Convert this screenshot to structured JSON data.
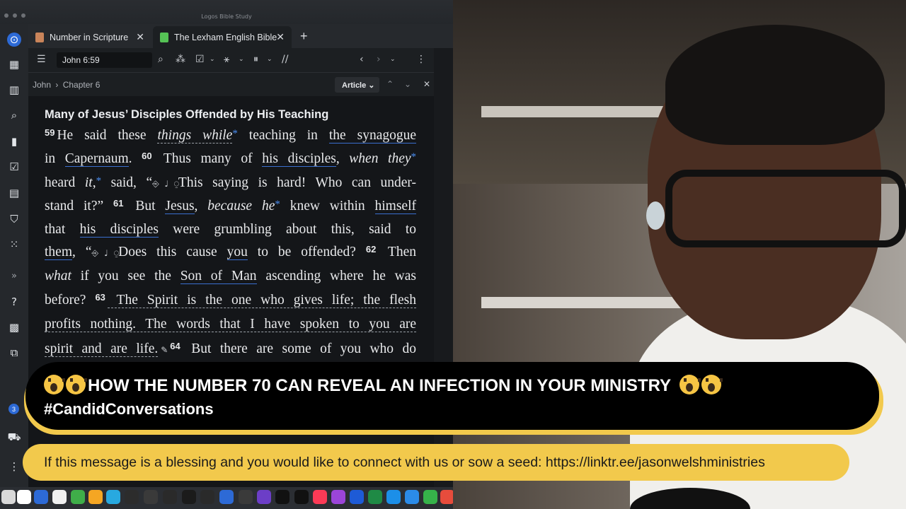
{
  "window": {
    "title": "Logos Bible Study"
  },
  "tabs": [
    {
      "label": "Number in Scripture",
      "icon_color": "#c9845a"
    },
    {
      "label": "The Lexham English Bible",
      "icon_color": "#55c255"
    }
  ],
  "toolbar": {
    "reference": "John 6:59"
  },
  "breadcrumb": {
    "book": "John",
    "separator": "›",
    "chapter": "Chapter 6"
  },
  "view": {
    "label": "Article ⌄"
  },
  "passage": {
    "heading": "Many of Jesus’ Disciples Offended by His Teaching",
    "lines": [
      "59 He said these things while* teaching in the synagogue",
      "in Capernaum. 60 Thus many of his disciples, when they*",
      "heard it,* said, “This saying is hard! Who can under-",
      "stand it?” 61 But Jesus, because he* knew within himself",
      "that his disciples were grumbling about this, said to",
      "them, “Does this cause you to be offended? 62 Then",
      "what if you see the Son of Man ascending where he was",
      "before? 63 The Spirit is the one who gives life; the flesh",
      "profits nothing. The words that I have spoken to you are",
      "spirit and are life. 64 But there are some of you who do"
    ],
    "l0": {
      "vn": "59",
      "a": "He said these ",
      "b": "things while",
      "c": "*",
      "d": " teaching in ",
      "e": "the synagogue"
    },
    "l1": {
      "a": "in ",
      "b": "Capernaum",
      "c": ". ",
      "vn": "60",
      "d": " Thus many of ",
      "e": "his disciples",
      "f": ", ",
      "g": "when they",
      "h": "*"
    },
    "l2": {
      "a": "heard ",
      "b": "it",
      "c": ",",
      "d": "*",
      "e": " said, “",
      "f": "This saying is hard! Who can under-"
    },
    "l3": {
      "a": "stand it?” ",
      "vn": "61",
      "b": " But ",
      "c": "Jesus",
      "d": ", ",
      "e": "because he",
      "f": "*",
      "g": " knew within ",
      "h": "himself"
    },
    "l4": {
      "a": "that ",
      "b": "his disciples",
      "c": " were grumbling about this, said to"
    },
    "l5": {
      "a": "them",
      "b": ", “",
      "c": "Does this cause ",
      "d": "you",
      "e": " to be offended? ",
      "vn": "62",
      "f": " Then"
    },
    "l6": {
      "a": "what",
      "b": " if you see the ",
      "c": "Son of Man",
      "d": " ascending where he was"
    },
    "l7": {
      "a": "before? ",
      "vn": "63",
      "b": " The Spirit is the one who gives life; the flesh"
    },
    "l8": {
      "a": "profits nothing. The words that I have spoken to you are"
    },
    "l9": {
      "a": "spirit and are life.",
      "b": " ",
      "vn": "64",
      "c": " But there are some of you who do"
    }
  },
  "icons": {
    "dictation": "dictation-glyph",
    "rail": [
      "logos-home-icon",
      "layouts-icon",
      "library-icon",
      "search-icon",
      "guides-icon",
      "checklist-icon",
      "documents-icon",
      "sermon-icon",
      "apps-icon",
      "more-icon",
      "help-icon",
      "panels-icon",
      "share-icon"
    ]
  },
  "rail_badge": "3",
  "banner": {
    "title": "HOW THE NUMBER 70 CAN REVEAL AN INFECTION IN YOUR MINISTRY",
    "hashtag": "#CandidConversations"
  },
  "ticker": {
    "text": "If this message is a blessing and you would like to connect with us or sow a seed: https://linktr.ee/jasonwelshministries"
  },
  "colors": {
    "banner_bg": "#000000",
    "accent_yellow": "#f2c94c",
    "link_blue": "#3a6fd0"
  }
}
